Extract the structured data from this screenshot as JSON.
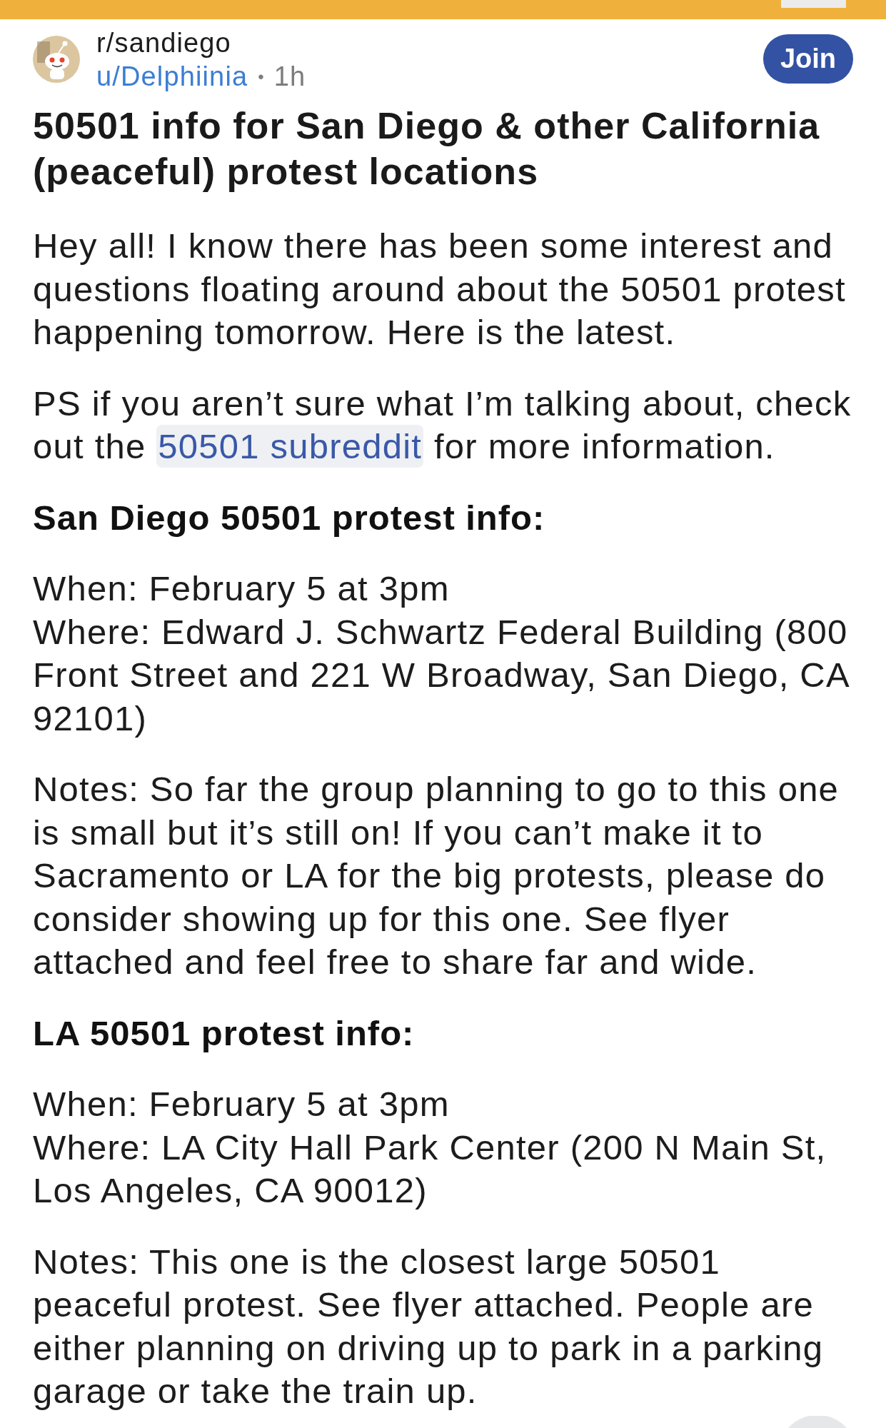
{
  "post": {
    "subreddit": "r/sandiego",
    "author": "u/Delphiinia",
    "separator": "•",
    "age": "1h",
    "join_label": "Join",
    "title": "50501 info for San Diego & other California (peaceful) protest locations",
    "body": [
      {
        "kind": "paragraph",
        "text": "Hey all! I know there has been some interest and questions floating around about the 50501 protest happening tomorrow. Here is the latest."
      },
      {
        "kind": "link_paragraph",
        "before": "PS if you aren’t sure what I’m talking about, check out the ",
        "link": "50501 subreddit",
        "after": " for more information."
      },
      {
        "kind": "heading",
        "text": "San Diego 50501 protest info:"
      },
      {
        "kind": "lines",
        "lines": [
          "When: February 5 at 3pm",
          "Where: Edward J. Schwartz Federal Building (800 Front Street and 221 W Broadway, San Diego, CA 92101)"
        ]
      },
      {
        "kind": "paragraph",
        "text": "Notes: So far the group planning to go to this one is small but it’s still on! If you can’t make it to Sacramento or LA for the big protests, please do consider showing up for this one. See flyer attached and feel free to share far and wide."
      },
      {
        "kind": "heading",
        "text": "LA 50501 protest info:"
      },
      {
        "kind": "lines",
        "lines": [
          "When: February 5 at 3pm",
          "Where: LA City Hall Park Center (200 N Main St, Los Angeles, CA 90012)"
        ]
      },
      {
        "kind": "paragraph",
        "text": "Notes: This one is the closest large 50501 peaceful protest. See flyer attached. People are either planning on driving up to park in a parking garage or take the train up."
      }
    ]
  }
}
